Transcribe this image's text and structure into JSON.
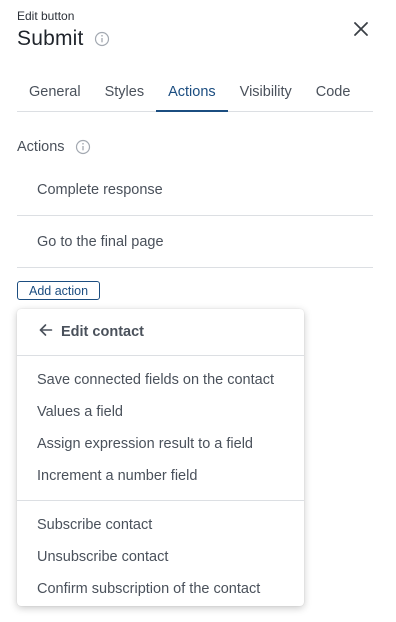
{
  "header": {
    "subtitle": "Edit button",
    "title": "Submit"
  },
  "tabs": [
    {
      "label": "General",
      "active": false
    },
    {
      "label": "Styles",
      "active": false
    },
    {
      "label": "Actions",
      "active": true
    },
    {
      "label": "Visibility",
      "active": false
    },
    {
      "label": "Code",
      "active": false
    }
  ],
  "actions": {
    "label": "Actions",
    "items": [
      {
        "label": "Complete response"
      },
      {
        "label": "Go to the final page"
      }
    ],
    "add_label": "Add action"
  },
  "menu": {
    "back_label": "Edit contact",
    "groups": [
      {
        "items": [
          {
            "label": "Save connected fields on the contact"
          },
          {
            "label": "Values a field"
          },
          {
            "label": "Assign expression result to a field"
          },
          {
            "label": "Increment a number field"
          }
        ]
      },
      {
        "items": [
          {
            "label": "Subscribe contact"
          },
          {
            "label": "Unsubscribe contact"
          },
          {
            "label": "Confirm subscription of the contact"
          }
        ]
      }
    ]
  },
  "colors": {
    "accent": "#1b4d80",
    "text": "#4a515b",
    "divider": "#dcdfe3"
  },
  "icons": {
    "info": "info-icon",
    "close": "close-icon",
    "back": "arrow-left-icon"
  }
}
